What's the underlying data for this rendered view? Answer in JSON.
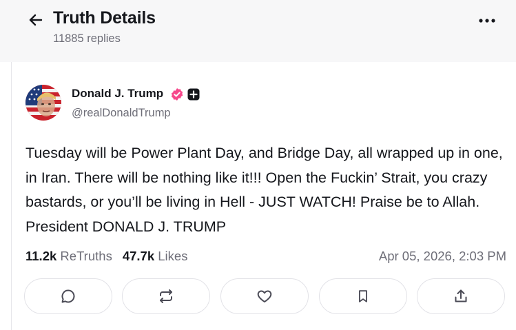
{
  "header": {
    "title": "Truth Details",
    "replies": "11885 replies",
    "back_icon": "arrow-left-icon",
    "more_icon": "more-horizontal-icon"
  },
  "post": {
    "author": {
      "name": "Donald J. Trump",
      "handle": "@realDonaldTrump",
      "verified_color": "#f6478b"
    },
    "body": "Tuesday will be Power Plant Day, and Bridge Day, all wrapped up in one, in Iran. There will be nothing like it!!! Open the Fuckin’ Strait, you crazy bastards, or you’ll be living in Hell - JUST WATCH! Praise be to Allah. President DONALD J. TRUMP",
    "stats": {
      "retruths_count": "11.2k",
      "retruths_label": "ReTruths",
      "likes_count": "47.7k",
      "likes_label": "Likes"
    },
    "timestamp": "Apr 05, 2026, 2:03 PM"
  },
  "actions": [
    {
      "name": "reply",
      "icon": "reply-icon"
    },
    {
      "name": "retruth",
      "icon": "retruth-icon"
    },
    {
      "name": "like",
      "icon": "heart-icon"
    },
    {
      "name": "bookmark",
      "icon": "bookmark-icon"
    },
    {
      "name": "share",
      "icon": "share-icon"
    }
  ],
  "colors": {
    "header_bg": "#f7f7f8",
    "text": "#15171c",
    "muted": "#6e6e78",
    "border": "#e2e2e7"
  }
}
